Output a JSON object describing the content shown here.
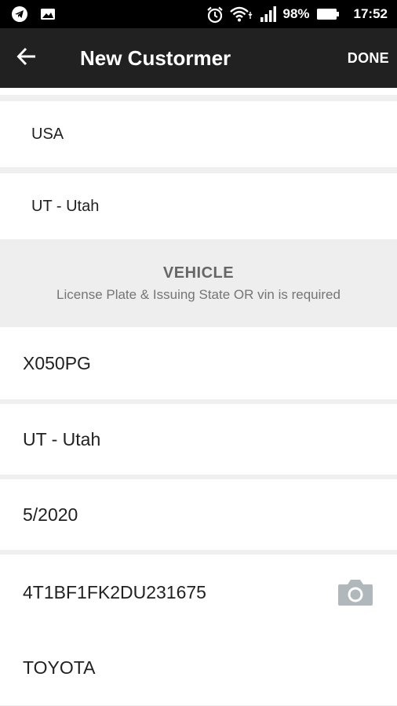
{
  "status_bar": {
    "battery": "98%",
    "time": "17:52",
    "icons": [
      "telegram-icon",
      "gallery-icon",
      "alarm-icon",
      "wifi-icon",
      "signal-icon",
      "battery-icon"
    ]
  },
  "app_bar": {
    "back_icon": "arrow-left-icon",
    "title": "New Custormer",
    "done_label": "DONE"
  },
  "customer": {
    "country": "USA",
    "state": "UT - Utah"
  },
  "vehicle_section": {
    "heading": "VEHICLE",
    "note": "License Plate & Issuing State OR vin is required"
  },
  "vehicle": {
    "license_plate": "X050PG",
    "issuing_state": "UT - Utah",
    "date": "5/2020",
    "vin": "4T1BF1FK2DU231675",
    "make": "TOYOTA",
    "scan_icon": "camera-icon"
  },
  "colors": {
    "status_bar": "#000000",
    "app_bar": "#212121",
    "divider": "#efefef",
    "section_bg": "#eeeeee",
    "camera_icon": "#b0b8bc"
  }
}
